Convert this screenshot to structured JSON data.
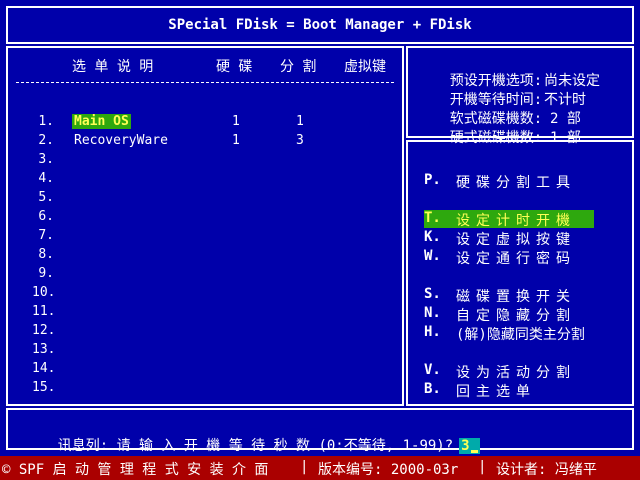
{
  "title": "SPecial FDisk = Boot Manager + FDisk",
  "list": {
    "headers": {
      "desc": "选 单 说 明",
      "disk": "硬 碟",
      "part": "分 割",
      "vkey": "虚拟键"
    },
    "rows": [
      {
        "num": "1.",
        "name": "Main OS",
        "disk": "1",
        "part": "1",
        "vkey": ""
      },
      {
        "num": "2.",
        "name": "RecoveryWare",
        "disk": "1",
        "part": "3",
        "vkey": ""
      },
      {
        "num": "3.",
        "name": "",
        "disk": "",
        "part": "",
        "vkey": ""
      },
      {
        "num": "4.",
        "name": "",
        "disk": "",
        "part": "",
        "vkey": ""
      },
      {
        "num": "5.",
        "name": "",
        "disk": "",
        "part": "",
        "vkey": ""
      },
      {
        "num": "6.",
        "name": "",
        "disk": "",
        "part": "",
        "vkey": ""
      },
      {
        "num": "7.",
        "name": "",
        "disk": "",
        "part": "",
        "vkey": ""
      },
      {
        "num": "8.",
        "name": "",
        "disk": "",
        "part": "",
        "vkey": ""
      },
      {
        "num": "9.",
        "name": "",
        "disk": "",
        "part": "",
        "vkey": ""
      },
      {
        "num": "10.",
        "name": "",
        "disk": "",
        "part": "",
        "vkey": ""
      },
      {
        "num": "11.",
        "name": "",
        "disk": "",
        "part": "",
        "vkey": ""
      },
      {
        "num": "12.",
        "name": "",
        "disk": "",
        "part": "",
        "vkey": ""
      },
      {
        "num": "13.",
        "name": "",
        "disk": "",
        "part": "",
        "vkey": ""
      },
      {
        "num": "14.",
        "name": "",
        "disk": "",
        "part": "",
        "vkey": ""
      },
      {
        "num": "15.",
        "name": "",
        "disk": "",
        "part": "",
        "vkey": ""
      }
    ]
  },
  "info": [
    {
      "label": "预设开機选项:",
      "value": "尚未设定"
    },
    {
      "label": "开機等待时间:",
      "value": "不计时"
    },
    {
      "label": "软式磁碟機数:",
      "value": "2 部"
    },
    {
      "label": "硬式磁碟機数:",
      "value": "1 部"
    }
  ],
  "menu": [
    {
      "key": "P.",
      "label": "硬碟分割工具"
    },
    {
      "key": "T.",
      "label": "设定计时开機"
    },
    {
      "key": "K.",
      "label": "设定虚拟按键"
    },
    {
      "key": "W.",
      "label": "设定通行密码"
    },
    {
      "key": "S.",
      "label": "磁碟置换开关"
    },
    {
      "key": "N.",
      "label": "自定隐藏分割"
    },
    {
      "key": "H.",
      "label": "(解)隐藏同类主分割"
    },
    {
      "key": "V.",
      "label": "设为活动分割"
    },
    {
      "key": "B.",
      "label": "回主选单"
    }
  ],
  "prompt": {
    "label": "讯息列:",
    "question": "请 输 入 开 機 等 待 秒 数 (0:不等待, 1-99)?",
    "input": "3"
  },
  "status": {
    "app": "© SPF 启 动 管 理 程 式 安 装 介 面",
    "version": "版本编号: 2000-03r",
    "designer": "设计者: 冯绪平"
  },
  "colors": {
    "background": "#0000aa",
    "selection": "#2ea80e",
    "selection_text": "#ffff55",
    "status_bar": "#aa0000",
    "input_cursor": "#00aaaa"
  }
}
